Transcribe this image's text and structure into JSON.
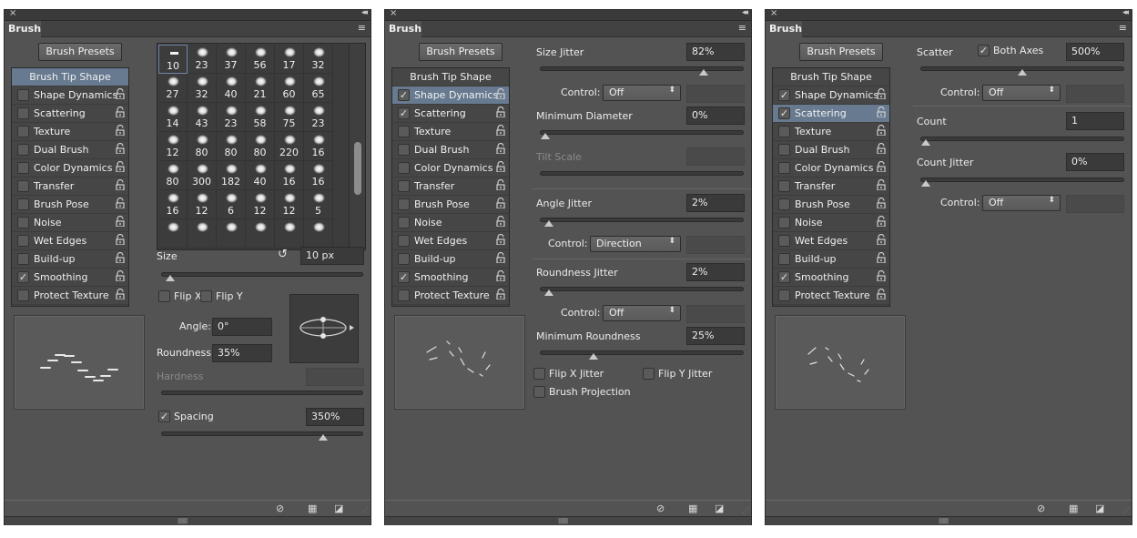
{
  "common": {
    "tab_title": "Brush",
    "close_glyph": "×",
    "collapse_glyph": "◂◂",
    "menu_glyph": "≡",
    "presets_button": "Brush Presets",
    "lock_glyph": "⊡",
    "check_glyph": "✓",
    "footer_icons": [
      "toggle-live-tip-preview-icon",
      "open-preset-manager-icon",
      "create-new-brush-icon"
    ],
    "accent_selected": "#677a90"
  },
  "panels": [
    {
      "selected_section": "Brush Tip Shape",
      "list": [
        {
          "label": "Brush Tip Shape",
          "header": true
        },
        {
          "label": "Shape Dynamics",
          "checked": false
        },
        {
          "label": "Scattering",
          "checked": false
        },
        {
          "label": "Texture",
          "checked": false
        },
        {
          "label": "Dual Brush",
          "checked": false
        },
        {
          "label": "Color Dynamics",
          "checked": false
        },
        {
          "label": "Transfer",
          "checked": false
        },
        {
          "label": "Brush Pose",
          "checked": false
        },
        {
          "label": "Noise",
          "checked": false
        },
        {
          "label": "Wet Edges",
          "checked": false
        },
        {
          "label": "Build-up",
          "checked": false
        },
        {
          "label": "Smoothing",
          "checked": true
        },
        {
          "label": "Protect Texture",
          "checked": false
        }
      ],
      "brush_sizes": [
        "10",
        "23",
        "37",
        "56",
        "17",
        "32",
        "27",
        "32",
        "40",
        "21",
        "60",
        "65",
        "14",
        "43",
        "23",
        "58",
        "75",
        "23",
        "12",
        "80",
        "80",
        "80",
        "220",
        "16",
        "80",
        "300",
        "182",
        "40",
        "16",
        "16",
        "16",
        "12",
        "6",
        "12",
        "12",
        "5"
      ],
      "size_label": "Size",
      "size_value": "10 px",
      "size_slider": 0.02,
      "flip_x": "Flip X",
      "flip_y": "Flip Y",
      "angle_label": "Angle:",
      "angle_value": "0°",
      "roundness_label": "Roundness:",
      "roundness_value": "35%",
      "hardness_label": "Hardness",
      "spacing_label": "Spacing",
      "spacing_checked": true,
      "spacing_value": "350%",
      "spacing_slider": 0.82
    },
    {
      "selected_section": "Shape Dynamics",
      "list": [
        {
          "label": "Brush Tip Shape",
          "header": true
        },
        {
          "label": "Shape Dynamics",
          "checked": true
        },
        {
          "label": "Scattering",
          "checked": true
        },
        {
          "label": "Texture",
          "checked": false
        },
        {
          "label": "Dual Brush",
          "checked": false
        },
        {
          "label": "Color Dynamics",
          "checked": false
        },
        {
          "label": "Transfer",
          "checked": false
        },
        {
          "label": "Brush Pose",
          "checked": false
        },
        {
          "label": "Noise",
          "checked": false
        },
        {
          "label": "Wet Edges",
          "checked": false
        },
        {
          "label": "Build-up",
          "checked": false
        },
        {
          "label": "Smoothing",
          "checked": true
        },
        {
          "label": "Protect Texture",
          "checked": false
        }
      ],
      "size_jitter_label": "Size Jitter",
      "size_jitter_value": "82%",
      "size_jitter_slider": 0.82,
      "control_label": "Control:",
      "control1_value": "Off",
      "min_diameter_label": "Minimum Diameter",
      "min_diameter_value": "0%",
      "min_diameter_slider": 0.0,
      "tilt_scale_label": "Tilt Scale",
      "angle_jitter_label": "Angle Jitter",
      "angle_jitter_value": "2%",
      "angle_jitter_slider": 0.02,
      "control2_value": "Direction",
      "roundness_jitter_label": "Roundness Jitter",
      "roundness_jitter_value": "2%",
      "roundness_jitter_slider": 0.02,
      "control3_value": "Off",
      "min_roundness_label": "Minimum Roundness",
      "min_roundness_value": "25%",
      "min_roundness_slider": 0.25,
      "flip_x_jitter": "Flip X Jitter",
      "flip_y_jitter": "Flip Y Jitter",
      "brush_projection": "Brush Projection"
    },
    {
      "selected_section": "Scattering",
      "list": [
        {
          "label": "Brush Tip Shape",
          "header": true
        },
        {
          "label": "Shape Dynamics",
          "checked": true
        },
        {
          "label": "Scattering",
          "checked": true
        },
        {
          "label": "Texture",
          "checked": false
        },
        {
          "label": "Dual Brush",
          "checked": false
        },
        {
          "label": "Color Dynamics",
          "checked": false
        },
        {
          "label": "Transfer",
          "checked": false
        },
        {
          "label": "Brush Pose",
          "checked": false
        },
        {
          "label": "Noise",
          "checked": false
        },
        {
          "label": "Wet Edges",
          "checked": false
        },
        {
          "label": "Build-up",
          "checked": false
        },
        {
          "label": "Smoothing",
          "checked": true
        },
        {
          "label": "Protect Texture",
          "checked": false
        }
      ],
      "scatter_label": "Scatter",
      "both_axes_label": "Both Axes",
      "both_axes_checked": true,
      "scatter_value": "500%",
      "scatter_slider": 0.5,
      "control_label": "Control:",
      "control1_value": "Off",
      "count_label": "Count",
      "count_value": "1",
      "count_slider": 0.0,
      "count_jitter_label": "Count Jitter",
      "count_jitter_value": "0%",
      "count_jitter_slider": 0.0,
      "control2_value": "Off"
    }
  ]
}
